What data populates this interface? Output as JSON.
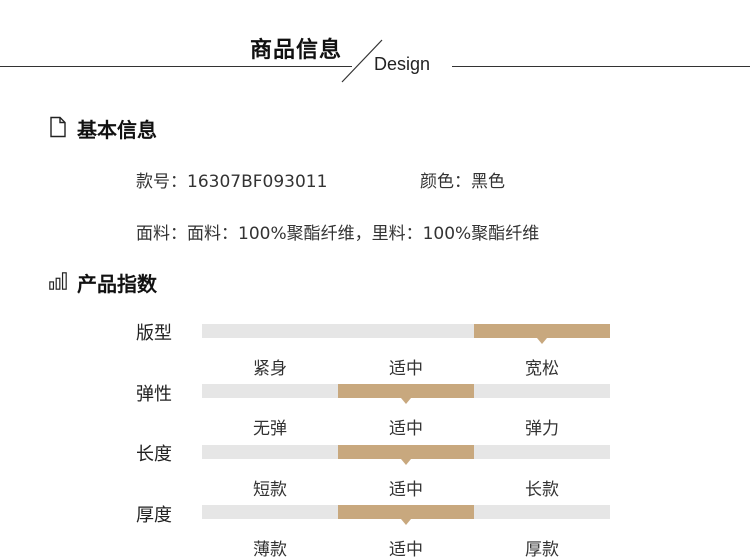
{
  "header": {
    "title": "商品信息",
    "subtitle": "Design"
  },
  "basic": {
    "title": "基本信息",
    "item_no": "款号：16307BF093011",
    "color": "颜色：黑色",
    "fabric": "面料：面料：100%聚酯纤维，里料：100%聚酯纤维"
  },
  "index": {
    "title": "产品指数",
    "rows": [
      {
        "label": "版型",
        "options": [
          "紧身",
          "适中",
          "宽松"
        ],
        "selected_index": 2
      },
      {
        "label": "弹性",
        "options": [
          "无弹",
          "适中",
          "弹力"
        ],
        "selected_index": 1
      },
      {
        "label": "长度",
        "options": [
          "短款",
          "适中",
          "长款"
        ],
        "selected_index": 1
      },
      {
        "label": "厚度",
        "options": [
          "薄款",
          "适中",
          "厚款"
        ],
        "selected_index": 1
      }
    ]
  },
  "colors": {
    "accent": "#c8a87e",
    "track": "#e6e6e6"
  },
  "icons": {
    "basic": "document-icon",
    "index": "bar-chart-icon"
  }
}
